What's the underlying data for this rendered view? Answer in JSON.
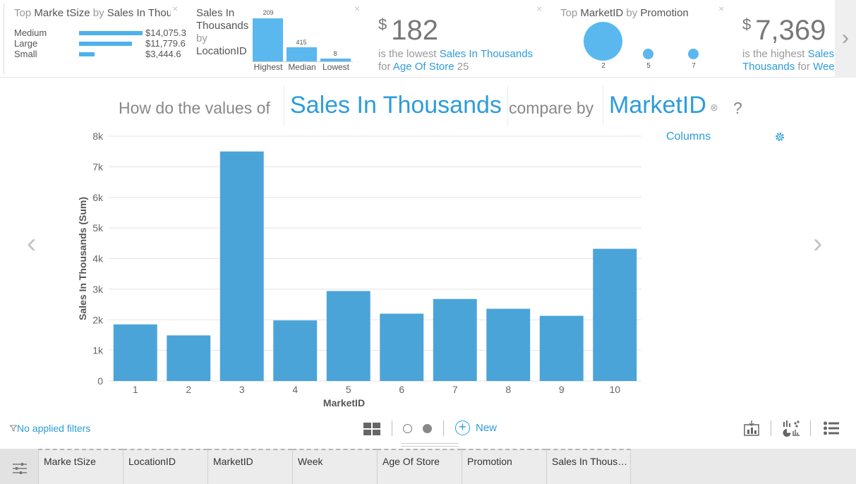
{
  "cards": {
    "card1": {
      "title_prefix": "Top ",
      "title_field": "Marke tSize",
      "title_mid": " by ",
      "title_measure": "Sales In Thousands",
      "rows": [
        {
          "label": "Medium",
          "value": "$14,075.3",
          "amount": 14075.3
        },
        {
          "label": "Large",
          "value": "$11,779.6",
          "amount": 11779.6
        },
        {
          "label": "Small",
          "value": "$3,444.6",
          "amount": 3444.6
        }
      ]
    },
    "card2": {
      "title_measure": "Sales In Thousands",
      "title_by": "by",
      "title_field": "LocationID",
      "bars": [
        {
          "label": "Highest",
          "num": "209",
          "level": 1.0
        },
        {
          "label": "Median",
          "num": "415",
          "level": 0.33
        },
        {
          "label": "Lowest",
          "num": "8",
          "level": 0.06
        }
      ]
    },
    "card3": {
      "currency": "$",
      "value": "182",
      "line1_prefix": "is the lowest ",
      "line1_measure": "Sales In Thousands",
      "line2_prefix": "for ",
      "line2_field": "Age Of Store",
      "line2_value": " 25"
    },
    "card4": {
      "title_prefix": "Top ",
      "title_field": "MarketID",
      "title_mid": " by ",
      "title_measure": "Promotion",
      "bubbles": [
        {
          "label": "2",
          "size": 1.0
        },
        {
          "label": "5",
          "size": 0.27
        },
        {
          "label": "7",
          "size": 0.27
        }
      ]
    },
    "card5": {
      "currency": "$",
      "value": "7,369",
      "line1_prefix": "is the highest ",
      "line1_measure": "Sales In",
      "line2_measure": "Thousands",
      "line2_mid": " for ",
      "line2_field": "Week"
    },
    "close_glyph": "×",
    "next_glyph": "›"
  },
  "question": {
    "part1": "How do the values of",
    "measure": "Sales In Thousands",
    "part2": "compare by",
    "dimension": "MarketID",
    "clear_glyph": "⊗",
    "end": "?"
  },
  "chart_type_label": "Columns",
  "nav": {
    "prev": "‹",
    "next": "›"
  },
  "chart_data": {
    "type": "bar",
    "categories": [
      "1",
      "2",
      "3",
      "4",
      "5",
      "6",
      "7",
      "8",
      "9",
      "10"
    ],
    "values": [
      1850,
      1490,
      7500,
      1980,
      2940,
      2200,
      2680,
      2360,
      2130,
      4320
    ],
    "xlabel": "MarketID",
    "ylabel": "Sales In Thousands (Sum)",
    "ylim": [
      0,
      8000
    ],
    "yticks": [
      "0",
      "1k",
      "2k",
      "3k",
      "4k",
      "5k",
      "6k",
      "7k",
      "8k"
    ],
    "grid": true,
    "color": "#4ba4d8"
  },
  "toolbar": {
    "filters_label": "No applied filters",
    "new_label": "New",
    "new_glyph": "+"
  },
  "table": {
    "columns": [
      "Marke tSize",
      "LocationID",
      "MarketID",
      "Week",
      "Age Of Store",
      "Promotion",
      "Sales In Thous…"
    ]
  },
  "colors": {
    "accent": "#2d9cdb",
    "bar": "#4ba4d8",
    "card_bar": "#5ab8ef"
  }
}
